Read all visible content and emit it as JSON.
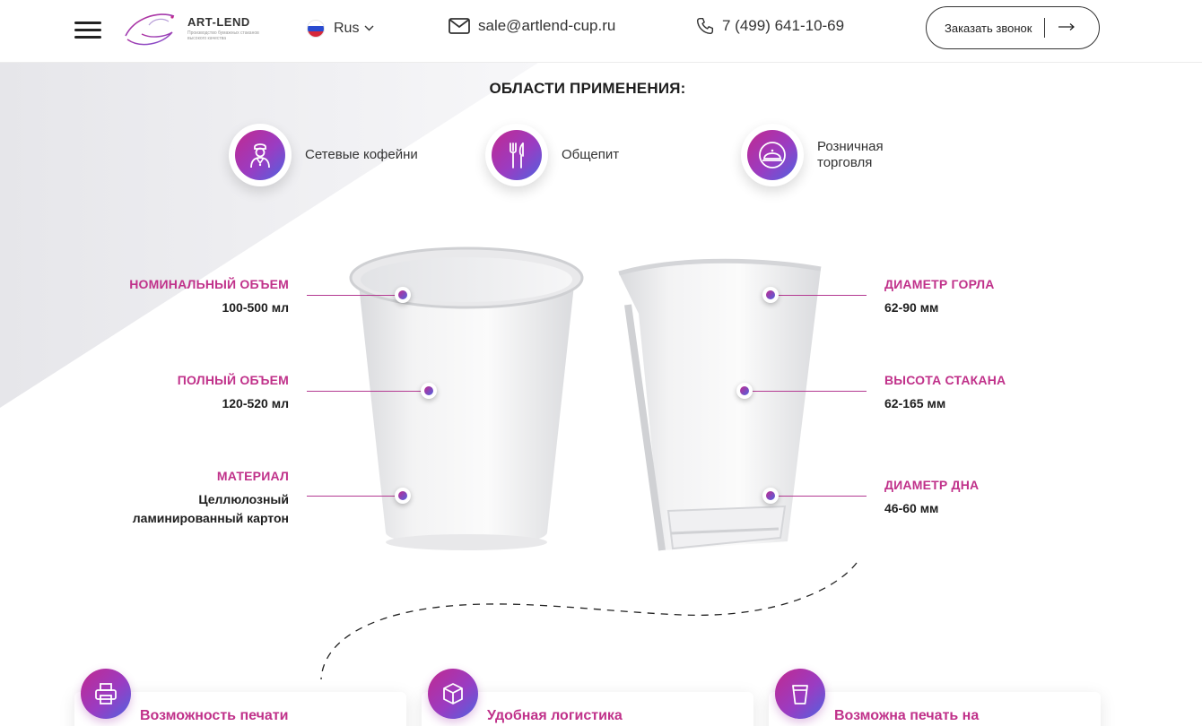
{
  "header": {
    "logo_name": "ART-LEND",
    "logo_tagline": "Производство бумажных стаканов высокого качества",
    "language": "Rus",
    "email": "sale@artlend-cup.ru",
    "phone": "7 (499) 641-10-69",
    "callback_label": "Заказать звонок"
  },
  "section": {
    "title": "ОБЛАСТИ ПРИМЕНЕНИЯ:"
  },
  "areas": [
    {
      "label": "Сетевые кофейни",
      "icon": "barista-icon"
    },
    {
      "label": "Общепит",
      "icon": "fork-knife-icon"
    },
    {
      "label": "Розничная торговля",
      "icon": "cloche-icon"
    }
  ],
  "specs": {
    "left": [
      {
        "title": "НОМИНАЛЬНЫЙ ОБЪЕМ",
        "value": "100-500 мл"
      },
      {
        "title": "ПОЛНЫЙ ОБЪЕМ",
        "value": "120-520 мл"
      },
      {
        "title": "МАТЕРИАЛ",
        "value": "Целлюлозный ламинированный картон"
      }
    ],
    "right": [
      {
        "title": "ДИАМЕТР ГОРЛА",
        "value": "62-90 мм"
      },
      {
        "title": "ВЫСОТА СТАКАНА",
        "value": "62-165 мм"
      },
      {
        "title": "ДИАМЕТР ДНА",
        "value": "46-60 мм"
      }
    ]
  },
  "features": [
    {
      "title": "Возможность печати",
      "icon": "printer-icon"
    },
    {
      "title": "Удобная логистика",
      "icon": "box-icon"
    },
    {
      "title": "Возможна печать на",
      "icon": "cup-icon"
    }
  ],
  "colors": {
    "accent": "#c0318a",
    "gradient_start": "#c1298f",
    "gradient_end": "#4f63e0",
    "text": "#1e1e1e"
  }
}
